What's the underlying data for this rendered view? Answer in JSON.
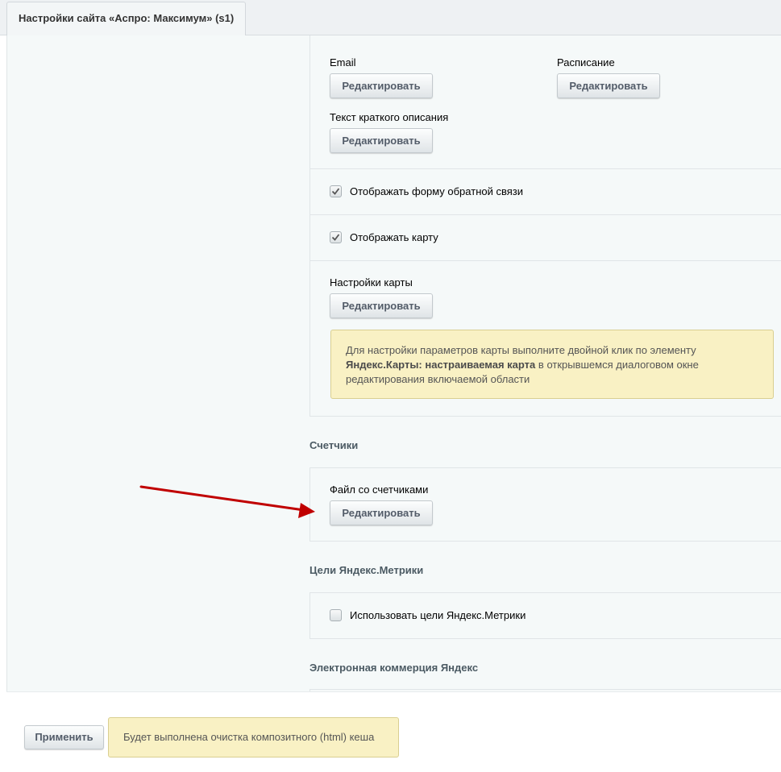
{
  "tab": {
    "title": "Настройки сайта «Аспро: Максимум» (s1)"
  },
  "contacts": {
    "email_label": "Email",
    "schedule_label": "Расписание",
    "short_text_label": "Текст краткого описания",
    "edit_label": "Редактировать"
  },
  "feedback_form": {
    "label": "Отображать форму обратной связи",
    "checked": true
  },
  "show_map": {
    "label": "Отображать карту",
    "checked": true
  },
  "map_settings": {
    "label": "Настройки карты",
    "edit_label": "Редактировать",
    "hint_start": "Для настройки параметров карты выполните двойной клик по элементу",
    "hint_bold": "Яндекс.Карты: настраиваемая карта",
    "hint_end": "в открывшемся диалоговом окне редактирования включаемой области"
  },
  "counters": {
    "title": "Счетчики",
    "file_label": "Файл со счетчиками",
    "edit_label": "Редактировать"
  },
  "metrika": {
    "title": "Цели Яндекс.Метрики",
    "checkbox_label": "Использовать цели Яндекс.Метрики",
    "checked": false
  },
  "ecommerce": {
    "title": "Электронная коммерция Яндекс"
  },
  "footer": {
    "apply_label": "Применить",
    "notice": "Будет выполнена очистка композитного (html) кеша"
  },
  "colors": {
    "arrow": "#c00000",
    "hint_bg": "#f9f1c4"
  }
}
